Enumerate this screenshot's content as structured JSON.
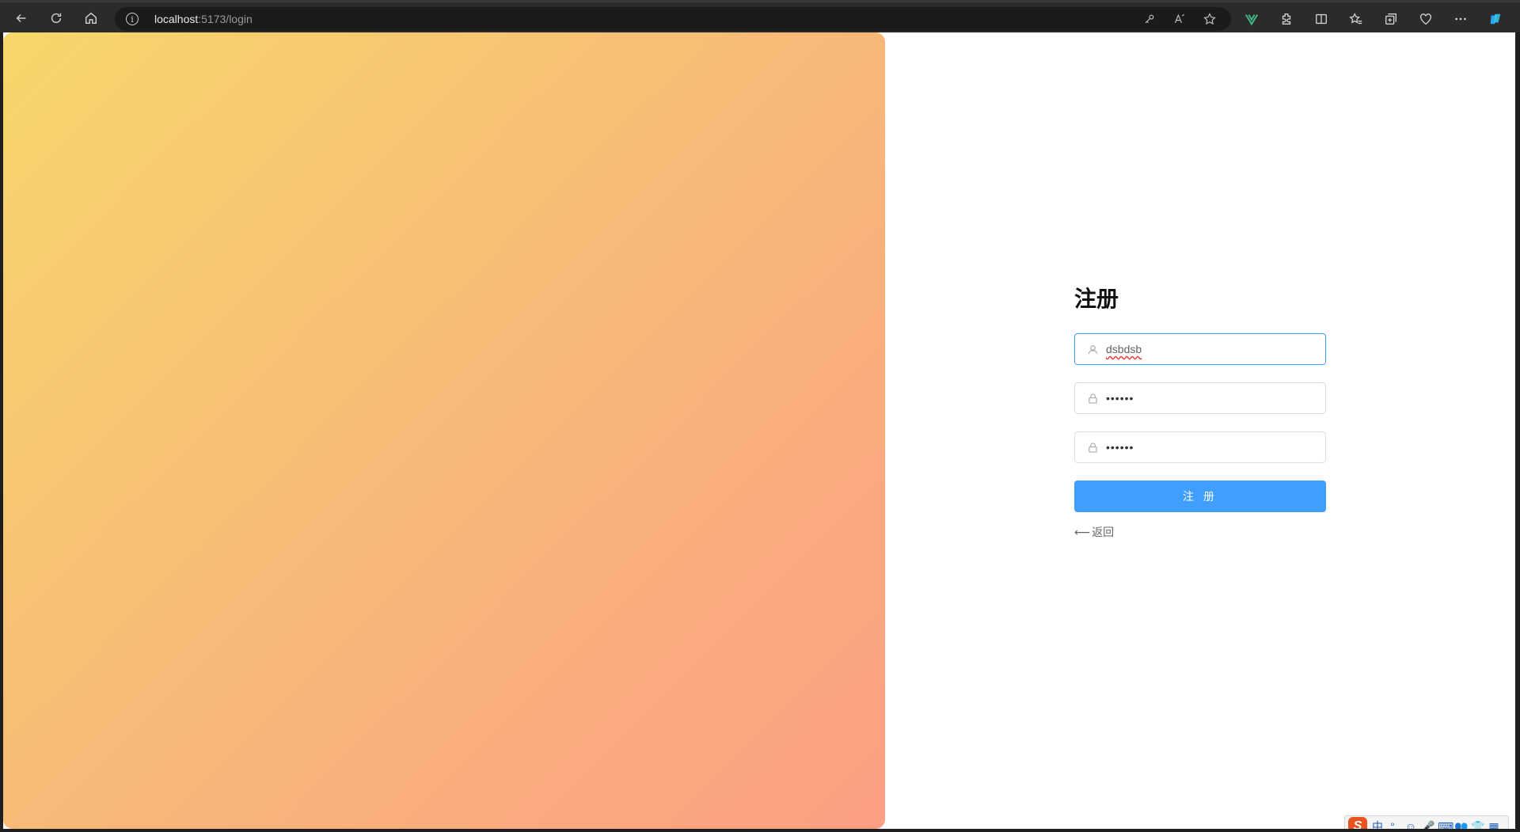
{
  "browser": {
    "url_host": "localhost",
    "url_path": ":5173/login"
  },
  "form": {
    "title": "注册",
    "username_value": "dsbdsb",
    "password_value": "••••••",
    "confirm_value": "••••••",
    "submit_label": "注 册",
    "back_label": "返回"
  },
  "ime": {
    "logo": "S",
    "items": [
      "中",
      "°,",
      "☺",
      "🎤",
      "⌨",
      "👥",
      "👕",
      "▦"
    ]
  },
  "colors": {
    "primary": "#409eff",
    "gradient_start": "#f7d76a",
    "gradient_end": "#fb9f84",
    "ime_logo": "#e8531f"
  }
}
